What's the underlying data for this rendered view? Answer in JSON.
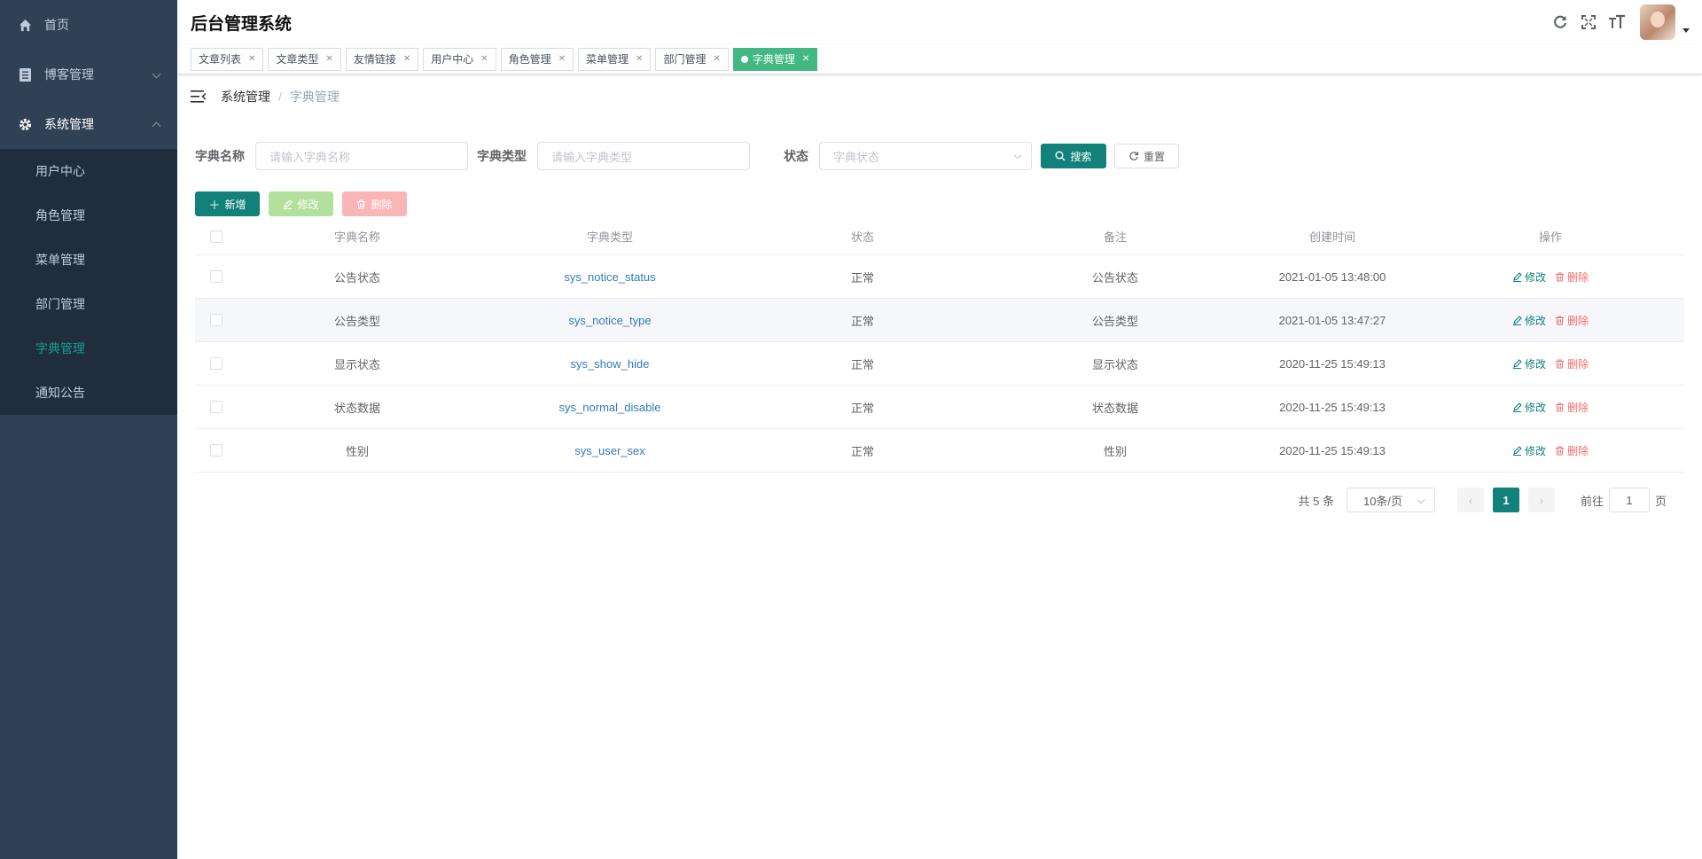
{
  "sidebar": {
    "items": [
      {
        "label": "首页",
        "icon": "home-icon"
      },
      {
        "label": "博客管理",
        "icon": "blog-icon"
      },
      {
        "label": "系统管理",
        "icon": "gear-icon"
      }
    ],
    "submenu": [
      "用户中心",
      "角色管理",
      "菜单管理",
      "部门管理",
      "字典管理",
      "通知公告"
    ],
    "active": "字典管理"
  },
  "header": {
    "title": "后台管理系统",
    "icons": [
      "refresh-icon",
      "fullscreen-icon",
      "font-size-icon"
    ]
  },
  "tags": [
    "文章列表",
    "文章类型",
    "友情链接",
    "用户中心",
    "角色管理",
    "菜单管理",
    "部门管理",
    "字典管理"
  ],
  "active_tag": "字典管理",
  "breadcrumb": {
    "level1": "系统管理",
    "separator": "/",
    "level2": "字典管理"
  },
  "search": {
    "name_label": "字典名称",
    "name_placeholder": "请输入字典名称",
    "type_label": "字典类型",
    "type_placeholder": "请输入字典类型",
    "status_label": "状态",
    "status_placeholder": "字典状态",
    "search_btn": "搜索",
    "reset_btn": "重置"
  },
  "toolbar": {
    "add": "新增",
    "edit": "修改",
    "delete": "删除"
  },
  "table": {
    "columns": [
      "字典名称",
      "字典类型",
      "状态",
      "备注",
      "创建时间",
      "操作"
    ],
    "rows": [
      {
        "name": "公告状态",
        "type": "sys_notice_status",
        "status": "正常",
        "remark": "公告状态",
        "created": "2021-01-05 13:48:00"
      },
      {
        "name": "公告类型",
        "type": "sys_notice_type",
        "status": "正常",
        "remark": "公告类型",
        "created": "2021-01-05 13:47:27"
      },
      {
        "name": "显示状态",
        "type": "sys_show_hide",
        "status": "正常",
        "remark": "显示状态",
        "created": "2020-11-25 15:49:13"
      },
      {
        "name": "状态数据",
        "type": "sys_normal_disable",
        "status": "正常",
        "remark": "状态数据",
        "created": "2020-11-25 15:49:13"
      },
      {
        "name": "性别",
        "type": "sys_user_sex",
        "status": "正常",
        "remark": "性别",
        "created": "2020-11-25 15:49:13"
      }
    ],
    "op_edit": "修改",
    "op_delete": "删除"
  },
  "pagination": {
    "total": "共 5 条",
    "page_size": "10条/页",
    "current_page": "1",
    "goto_prefix": "前往",
    "goto_value": "1",
    "goto_suffix": "页"
  },
  "colors": {
    "sidebar_bg": "#304156",
    "primary": "#11817a",
    "active_tag": "#42b983",
    "danger": "#f56c6c"
  }
}
